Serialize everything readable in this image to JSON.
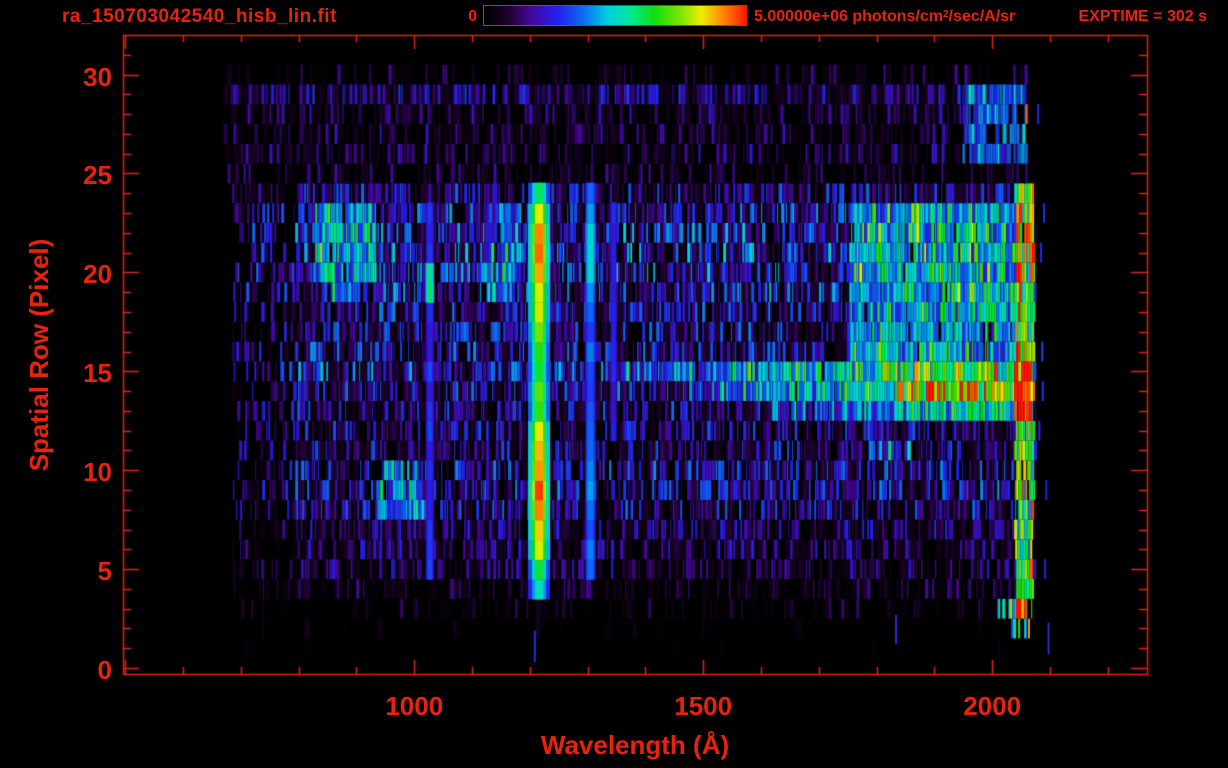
{
  "header": {
    "exptime_label": "EXPTIME = 302 s",
    "colorbar_min_label": "0",
    "colorbar_max_prefix": "5.00000e+06 photons/cm",
    "colorbar_max_sup": "2",
    "colorbar_max_suffix": "/sec/A/sr"
  },
  "colors": {
    "accent_red": "#e8220f",
    "background": "#000000",
    "bottom_mark_blue": "#2a2ad0"
  },
  "chart_data": {
    "type": "heatmap",
    "title": "ra_150703042540_hisb_lin.fit",
    "xlabel": "Wavelength (Å)",
    "ylabel": "Spatial Row (Pixel)",
    "colorbar": {
      "min_value": 0,
      "max_value": 5000000,
      "units": "photons/cm2/sec/A/sr"
    },
    "exposure_time_s": 302,
    "x_axis": {
      "min": 496,
      "max": 2268,
      "major_tick_step": 500,
      "minor_tick_step": 100,
      "ticks": [
        {
          "v": 1000,
          "label": "1000"
        },
        {
          "v": 1500,
          "label": "1500"
        },
        {
          "v": 2000,
          "label": "2000"
        }
      ]
    },
    "y_axis": {
      "min": -0.3,
      "max": 32.0,
      "major_tick_step": 5,
      "minor_tick_step": 1,
      "ticks": [
        {
          "v": 0,
          "label": "0"
        },
        {
          "v": 5,
          "label": "5"
        },
        {
          "v": 10,
          "label": "10"
        },
        {
          "v": 15,
          "label": "15"
        },
        {
          "v": 20,
          "label": "20"
        },
        {
          "v": 25,
          "label": "25"
        },
        {
          "v": 30,
          "label": "30"
        }
      ]
    },
    "colormap_stops": [
      [
        0.0,
        "#000000"
      ],
      [
        0.09,
        "#1c0228"
      ],
      [
        0.18,
        "#45079e"
      ],
      [
        0.28,
        "#2420ee"
      ],
      [
        0.38,
        "#0b6df0"
      ],
      [
        0.47,
        "#00cfe0"
      ],
      [
        0.56,
        "#00e896"
      ],
      [
        0.65,
        "#11dd11"
      ],
      [
        0.75,
        "#7fe400"
      ],
      [
        0.83,
        "#eeee00"
      ],
      [
        0.9,
        "#ff9500"
      ],
      [
        0.96,
        "#ff4d00"
      ],
      [
        1.0,
        "#ff1500"
      ]
    ],
    "data_extent": {
      "wl_min": 670,
      "wl_max": 2073,
      "wl_dense_start": 795,
      "row_min": 0,
      "row_max": 30
    },
    "row_base": [
      0.0,
      0.03,
      0.05,
      0.08,
      0.1,
      0.14,
      0.15,
      0.16,
      0.2,
      0.22,
      0.22,
      0.2,
      0.19,
      0.2,
      0.22,
      0.24,
      0.22,
      0.21,
      0.22,
      0.24,
      0.26,
      0.26,
      0.26,
      0.24,
      0.2,
      0.11,
      0.13,
      0.12,
      0.13,
      0.17,
      0.1
    ],
    "row_density": [
      0.02,
      0.04,
      0.1,
      0.28,
      0.45,
      0.62,
      0.68,
      0.7,
      0.78,
      0.8,
      0.78,
      0.76,
      0.74,
      0.8,
      0.85,
      0.86,
      0.8,
      0.78,
      0.8,
      0.84,
      0.86,
      0.86,
      0.86,
      0.84,
      0.78,
      0.45,
      0.55,
      0.5,
      0.55,
      0.8,
      0.35
    ],
    "emission_lines": [
      {
        "name": "Lyman-alpha",
        "wl": 1216,
        "half_widths": [
          11,
          7,
          4
        ],
        "row_start": 4,
        "profile": [
          0.5,
          0.62,
          0.78,
          0.82,
          0.9,
          0.93,
          0.88,
          0.84,
          0.8,
          0.68,
          0.73,
          0.66,
          0.7,
          0.74,
          0.78,
          0.82,
          0.9,
          0.93,
          0.9,
          0.82,
          0.6
        ]
      },
      {
        "name": "Lyman-beta",
        "wl": 1027,
        "half_widths": [
          4,
          2
        ],
        "rows": [
          5,
          23
        ],
        "base_intensity": 0.3,
        "peaks": [
          {
            "rows": [
              19,
              20
            ],
            "intensity": 0.55
          }
        ]
      },
      {
        "name": "OI-1304",
        "wl": 1305,
        "half_widths": [
          5,
          3
        ],
        "rows": [
          5,
          24
        ],
        "base_intensity": 0.36,
        "peaks": [
          {
            "rows": [
              19,
              23
            ],
            "intensity": 0.48
          },
          {
            "rows": [
              8,
              10
            ],
            "intensity": 0.42
          }
        ]
      },
      {
        "name": "line-1345",
        "wl": 1345,
        "half_widths": [
          3,
          2
        ],
        "rows": [
          12,
          23
        ],
        "base_intensity": 0.26,
        "peaks": []
      }
    ],
    "regions": [
      {
        "name": "right-edge-bright-column",
        "wl": [
          2040,
          2073
        ],
        "rows": [
          3,
          24
        ],
        "boost": 0.55,
        "red_spike_rows": [
          3,
          5,
          9,
          13,
          14,
          17,
          21,
          22
        ]
      },
      {
        "name": "edge-bottom-cluster",
        "wl": [
          2008,
          2062
        ],
        "rows": [
          2,
          3
        ],
        "boost": 0.5
      },
      {
        "name": "continuum-green-patch",
        "wl": [
          1755,
          2050
        ],
        "rows": [
          16,
          23
        ],
        "boost": 0.3
      },
      {
        "name": "streak-row-15",
        "wl": [
          1340,
          2068
        ],
        "rows": [
          15,
          15
        ],
        "ramp": [
          0.1,
          0.55
        ]
      },
      {
        "name": "streak-row-14",
        "wl": [
          1490,
          2068
        ],
        "rows": [
          14,
          14
        ],
        "ramp": [
          0.15,
          0.62
        ]
      },
      {
        "name": "streak-row-14-hot",
        "wl": [
          1840,
          1975
        ],
        "rows": [
          14,
          14
        ],
        "boost": 0.22
      },
      {
        "name": "streak-row-13",
        "wl": [
          1620,
          2068
        ],
        "rows": [
          13,
          13
        ],
        "ramp": [
          0.12,
          0.48
        ]
      },
      {
        "name": "cyan-blob-upper-left",
        "wl": [
          828,
          935
        ],
        "rows": [
          20,
          23
        ],
        "boost": 0.28
      },
      {
        "name": "cyan-blob-row19",
        "wl": [
          845,
          905
        ],
        "rows": [
          19,
          19
        ],
        "boost": 0.22
      },
      {
        "name": "cyan-patch-rows8-10",
        "wl": [
          935,
          1015
        ],
        "rows": [
          8,
          10
        ],
        "boost": 0.22
      },
      {
        "name": "cyan-streaks-1150",
        "wl": [
          1120,
          1185
        ],
        "rows": [
          19,
          23
        ],
        "boost": 0.16
      },
      {
        "name": "cyan-row11",
        "wl": [
          1780,
          1860
        ],
        "rows": [
          11,
          11
        ],
        "boost": 0.2
      },
      {
        "name": "top-right-green",
        "wl": [
          1950,
          2062
        ],
        "rows": [
          26,
          29
        ],
        "boost": 0.26
      }
    ],
    "bottom_marks": [
      {
        "wl": 1207,
        "rows": [
          0.3,
          1.9
        ]
      },
      {
        "wl": 1832,
        "rows": [
          1.2,
          2.7
        ]
      },
      {
        "wl": 2096,
        "rows": [
          0.7,
          2.3
        ]
      }
    ],
    "stray_pixels": [
      {
        "wl": 2088,
        "row": 23,
        "i": 0.3
      },
      {
        "wl": 2080,
        "row": 12,
        "i": 0.3
      },
      {
        "wl": 2085,
        "row": 16,
        "i": 0.32
      },
      {
        "wl": 2092,
        "row": 9,
        "i": 0.28
      },
      {
        "wl": 2078,
        "row": 28,
        "i": 0.3
      },
      {
        "wl": 2083,
        "row": 21,
        "i": 0.3
      },
      {
        "wl": 2090,
        "row": 5,
        "i": 0.27
      },
      {
        "wl": 2086,
        "row": 14,
        "i": 0.3
      },
      {
        "wl": 2058,
        "row": 28,
        "i": 0.95
      },
      {
        "wl": 2062,
        "row": 2,
        "i": 0.9
      }
    ],
    "seed": 1150703
  }
}
